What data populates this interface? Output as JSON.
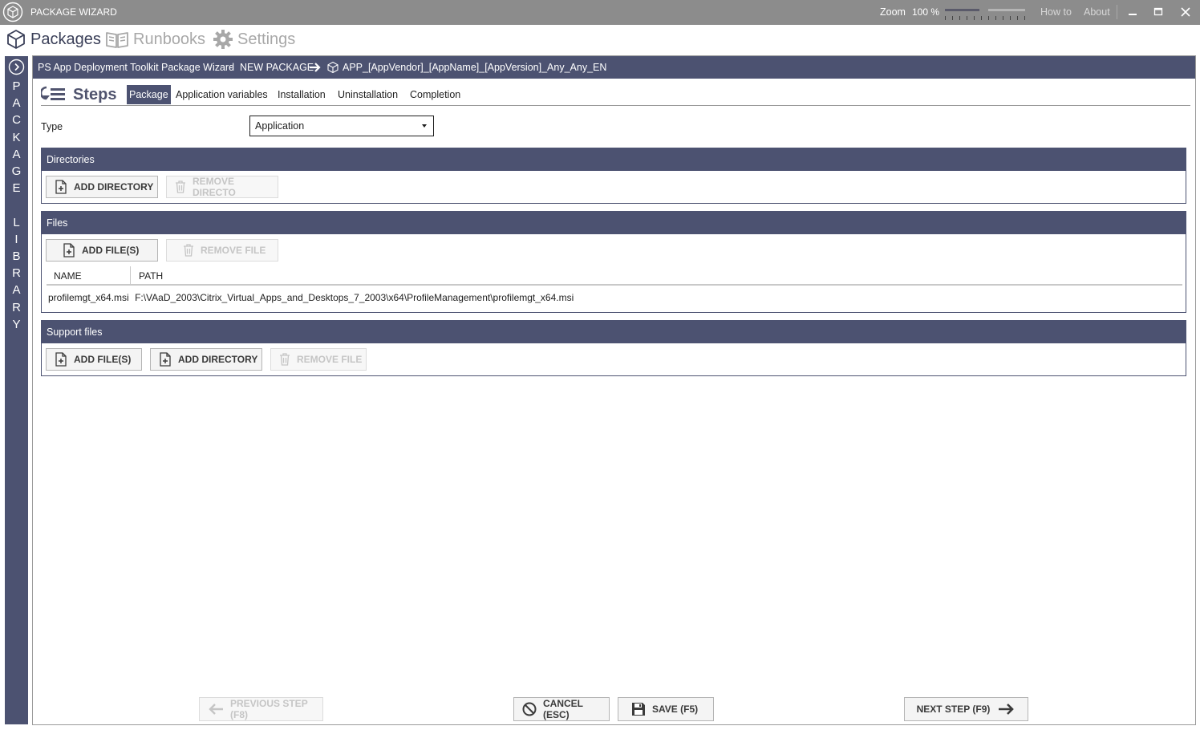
{
  "window": {
    "title": "PACKAGE WIZARD",
    "zoom_label": "Zoom",
    "zoom_value": "100 %",
    "zoom_fraction": 0.45,
    "links": {
      "how_to": "How to",
      "about": "About"
    },
    "controls": {
      "minimize": "‒",
      "maximize": "□",
      "close": "✕"
    }
  },
  "main_nav": [
    {
      "label": "Packages",
      "icon": "package-icon",
      "active": true
    },
    {
      "label": "Runbooks",
      "icon": "book-icon",
      "active": false
    },
    {
      "label": "Settings",
      "icon": "gear-icon",
      "active": false
    }
  ],
  "sidebar": {
    "label": "PACKAGE LIBRARY",
    "icon": "chevron-right-circle-icon"
  },
  "header": {
    "app_title": "PS App Deployment Toolkit Package Wizard",
    "separator": "-",
    "new_package": "NEW PACKAGE",
    "package_name": "APP_[AppVendor]_[AppName]_[AppVersion]_Any_Any_EN"
  },
  "steps": {
    "title": "Steps",
    "tabs": [
      "Package",
      "Application variables",
      "Installation",
      "Uninstallation",
      "Completion"
    ],
    "active_tab": "Package"
  },
  "form": {
    "type_label": "Type",
    "type_value": "Application"
  },
  "directories": {
    "title": "Directories",
    "add_button": "ADD DIRECTORY",
    "remove_button": "REMOVE DIRECTO"
  },
  "files": {
    "title": "Files",
    "add_button": "ADD FILE(S)",
    "remove_button": "REMOVE FILE",
    "columns": [
      "NAME",
      "PATH"
    ],
    "rows": [
      {
        "name": "profilemgt_x64.msi",
        "path": "F:\\VAaD_2003\\Citrix_Virtual_Apps_and_Desktops_7_2003\\x64\\ProfileManagement\\profilemgt_x64.msi"
      }
    ]
  },
  "support_files": {
    "title": "Support files",
    "add_files_button": "ADD FILE(S)",
    "add_directory_button": "ADD DIRECTORY",
    "remove_button": "REMOVE FILE"
  },
  "footer": {
    "previous": "PREVIOUS STEP (F8)",
    "cancel": "CANCEL (ESC)",
    "save": "SAVE (F5)",
    "next": "NEXT STEP (F9)"
  },
  "colors": {
    "accent": "#4c5271",
    "titlebar": "#8c8c8c",
    "disabled_text": "#c5c5c5"
  }
}
